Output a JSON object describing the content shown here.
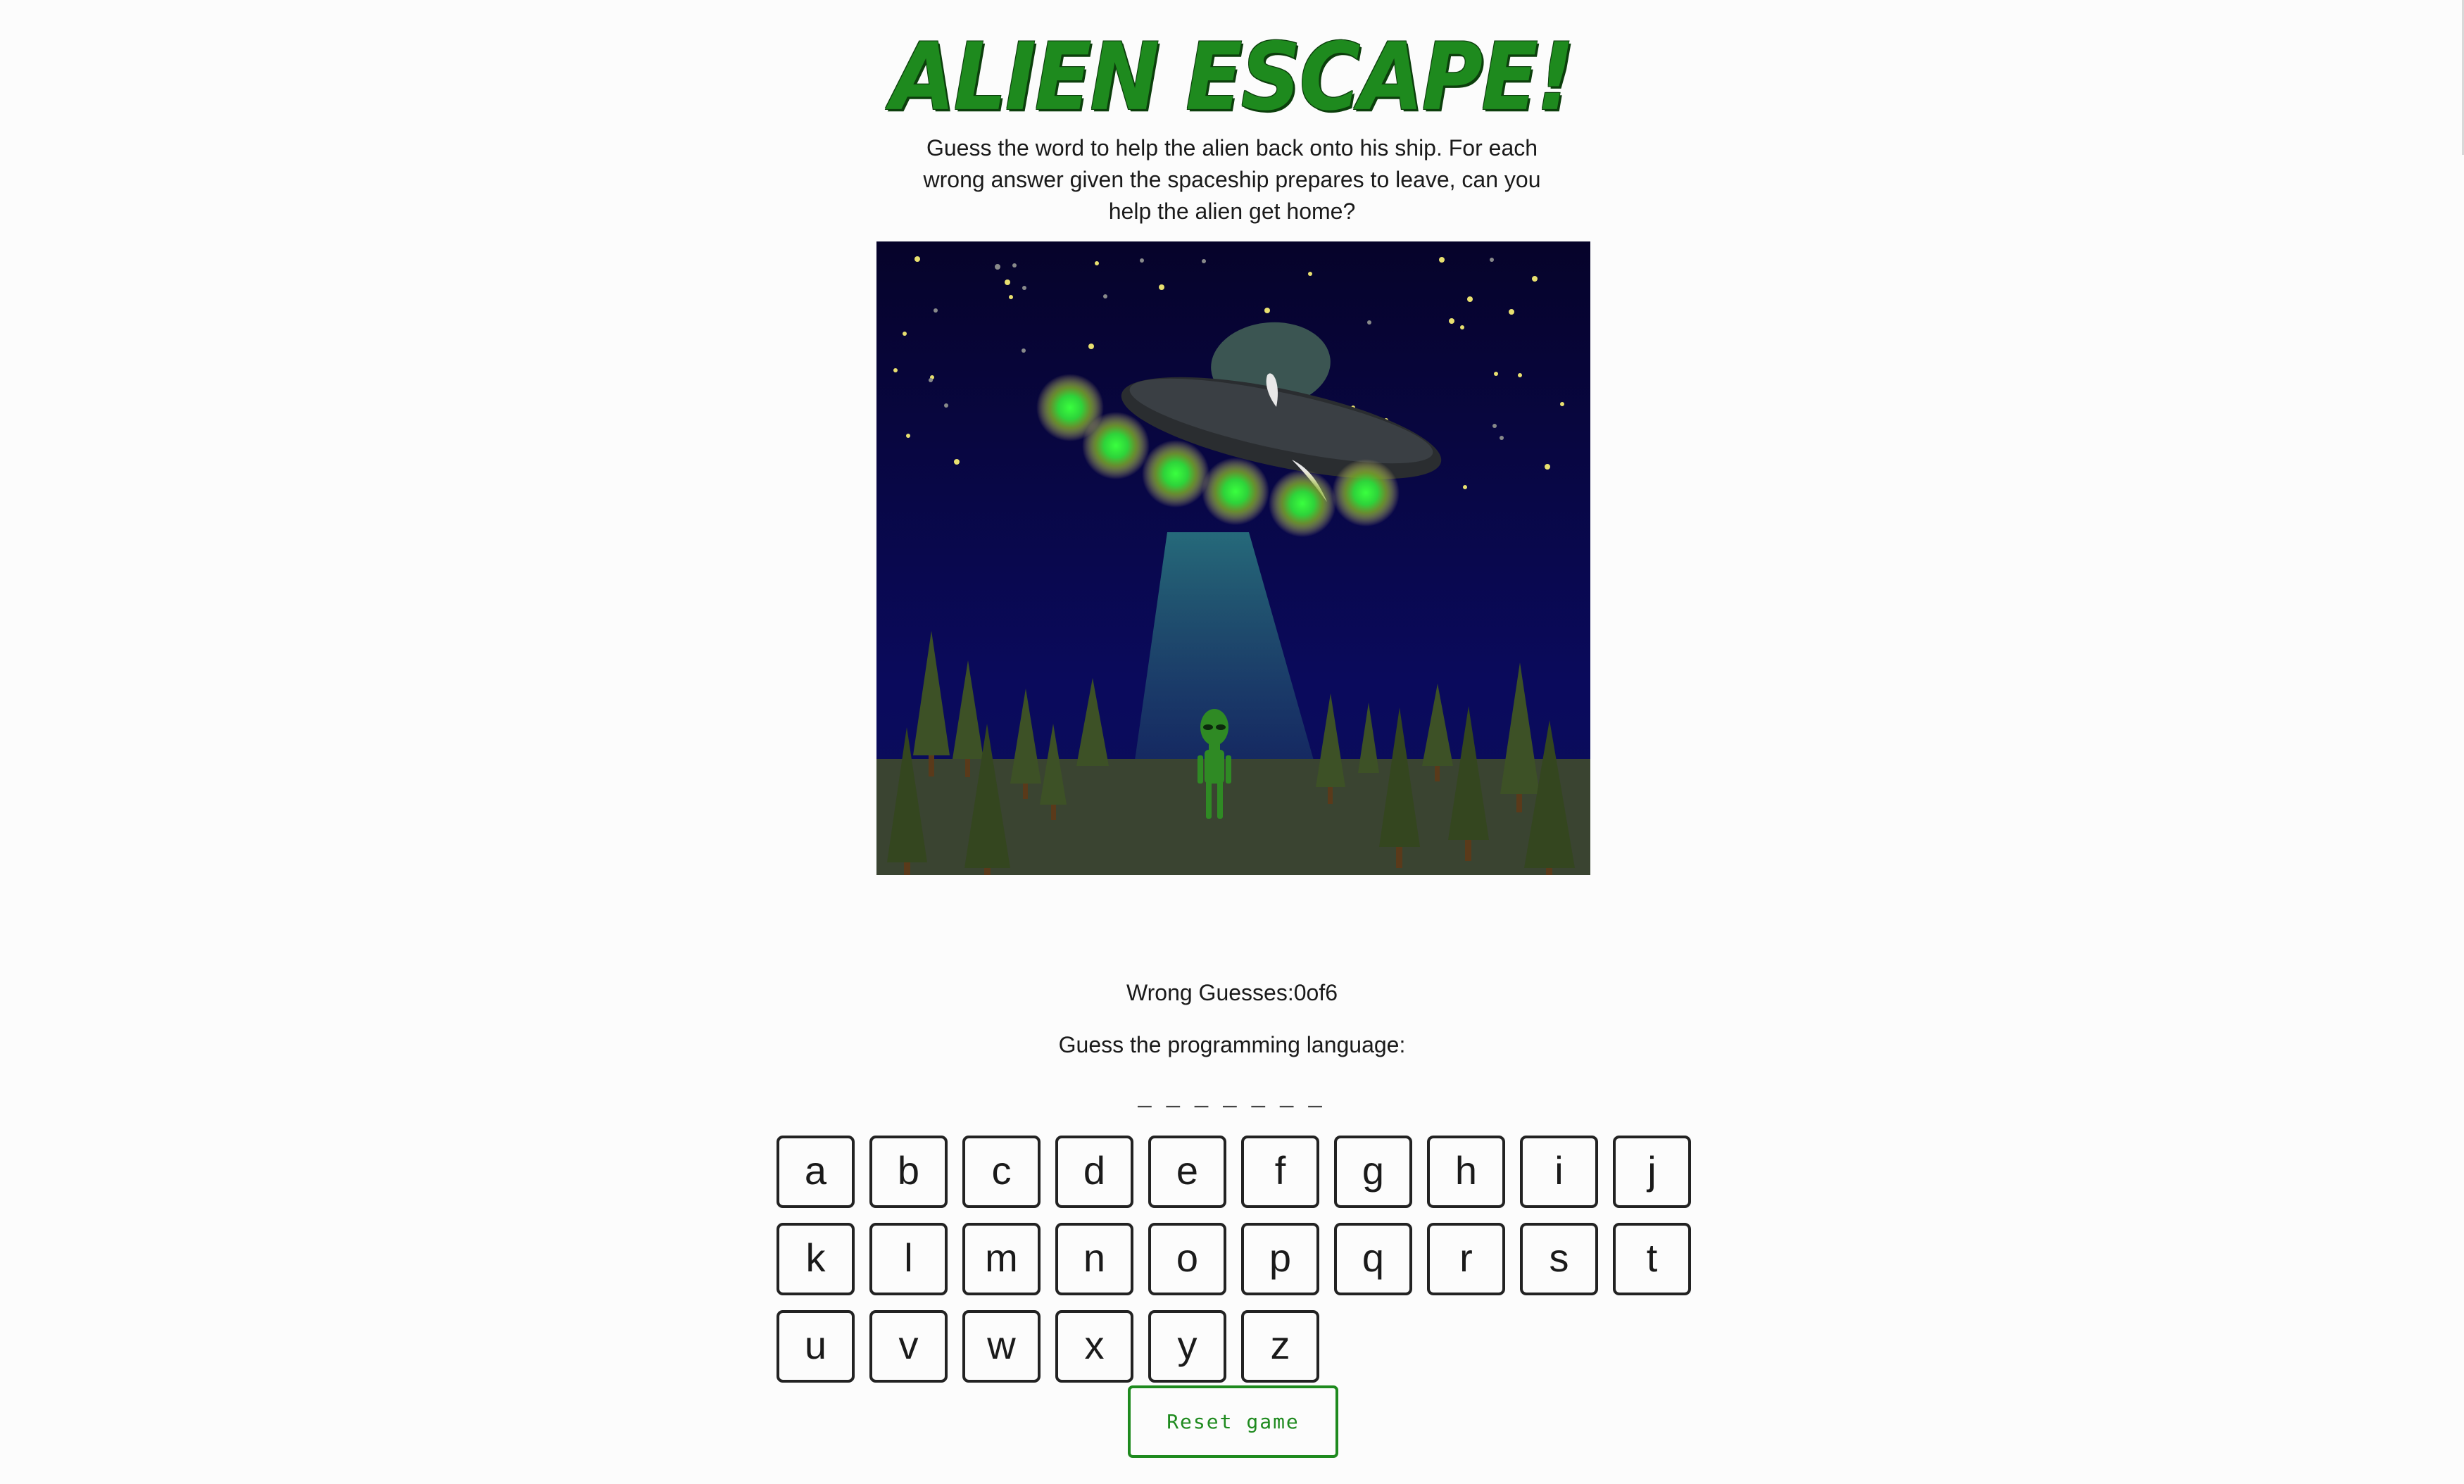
{
  "header": {
    "title": "Alien Escape!",
    "intro": "Guess the word to help the alien back onto his ship. For each wrong answer given the spaceship prepares to leave, can you help the alien get home?"
  },
  "status": {
    "wrong_label": "Wrong Guesses:",
    "wrong_count": "0",
    "wrong_of": "of",
    "wrong_max": "6",
    "prompt": "Guess the programming language:",
    "word_blanks": "_ _ _ _ _ _ _"
  },
  "keyboard": {
    "letters": [
      "a",
      "b",
      "c",
      "d",
      "e",
      "f",
      "g",
      "h",
      "i",
      "j",
      "k",
      "l",
      "m",
      "n",
      "o",
      "p",
      "q",
      "r",
      "s",
      "t",
      "u",
      "v",
      "w",
      "x",
      "y",
      "z"
    ]
  },
  "controls": {
    "reset_label": "Reset game"
  },
  "colors": {
    "accent": "#1e8a1e",
    "sky": "#07063a",
    "ground": "#3a4431",
    "ufo_light": "#39ff3e"
  }
}
